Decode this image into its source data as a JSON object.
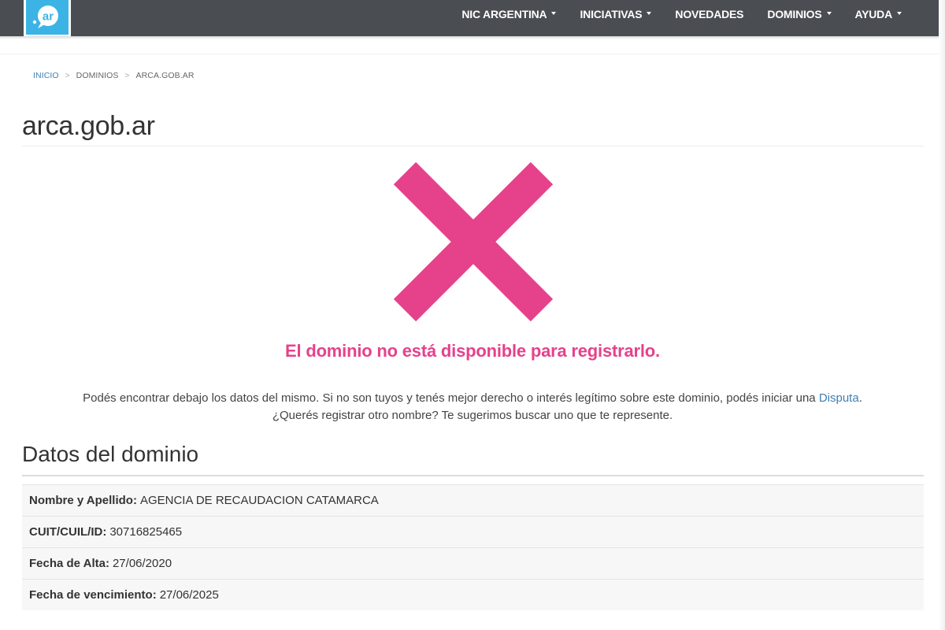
{
  "brand": {
    "logo_text": ".ar",
    "logo_color": "#3bb4e5"
  },
  "nav": {
    "items": [
      {
        "label": "NIC ARGENTINA",
        "dropdown": true
      },
      {
        "label": "INICIATIVAS",
        "dropdown": true
      },
      {
        "label": "NOVEDADES",
        "dropdown": false
      },
      {
        "label": "DOMINIOS",
        "dropdown": true
      },
      {
        "label": "AYUDA",
        "dropdown": true
      }
    ]
  },
  "breadcrumb": {
    "home": "INICIO",
    "section": "DOMINIOS",
    "current": "ARCA.GOB.AR",
    "separator": ">"
  },
  "page": {
    "title": "arca.gob.ar"
  },
  "status": {
    "icon": "x-icon",
    "color": "#e5428b",
    "message": "El dominio no está disponible para registrarlo."
  },
  "info": {
    "line1_text": "Podés encontrar debajo los datos del mismo. Si no son tuyos y tenés mejor derecho o interés legítimo sobre este dominio, podés iniciar una ",
    "dispute_link": "Disputa",
    "line1_end": ".",
    "line2": "¿Querés registrar otro nombre? Te sugerimos buscar uno que te represente."
  },
  "domain_data": {
    "title": "Datos del dominio",
    "rows": [
      {
        "label": "Nombre y Apellido:",
        "value": "AGENCIA DE RECAUDACION CATAMARCA"
      },
      {
        "label": "CUIT/CUIL/ID:",
        "value": "30716825465"
      },
      {
        "label": "Fecha de Alta:",
        "value": "27/06/2020"
      },
      {
        "label": "Fecha de vencimiento:",
        "value": "27/06/2025"
      }
    ]
  }
}
